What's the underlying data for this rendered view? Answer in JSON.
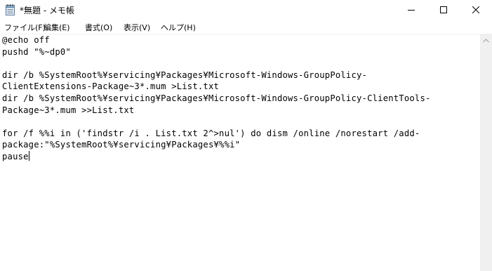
{
  "window": {
    "title": "*無題 - メモ帳",
    "app_icon": "notepad-icon",
    "controls": {
      "minimize_icon": "minimize-icon",
      "maximize_icon": "maximize-icon",
      "close_icon": "close-icon"
    }
  },
  "menu": {
    "items": [
      {
        "label": "ファイル(F)"
      },
      {
        "label": "編集(E)"
      },
      {
        "label": "書式(O)"
      },
      {
        "label": "表示(V)"
      },
      {
        "label": "ヘルプ(H)"
      }
    ]
  },
  "editor": {
    "lines": [
      "@echo off",
      "pushd \"%~dp0\"",
      "",
      "dir /b %SystemRoot%¥servicing¥Packages¥Microsoft-Windows-GroupPolicy-",
      "ClientExtensions-Package~3*.mum >List.txt",
      "dir /b %SystemRoot%¥servicing¥Packages¥Microsoft-Windows-GroupPolicy-ClientTools-",
      "Package~3*.mum >>List.txt",
      "",
      "for /f %%i in ('findstr /i . List.txt 2^>nul') do dism /online /norestart /add-",
      "package:\"%SystemRoot%¥servicing¥Packages¥%%i\"",
      "pause"
    ]
  },
  "scrollbar": {
    "up_icon": "scroll-up-arrow-icon"
  },
  "colors": {
    "background": "#ffffff",
    "text": "#000000",
    "scrollbar_track": "#f0f0f0"
  }
}
